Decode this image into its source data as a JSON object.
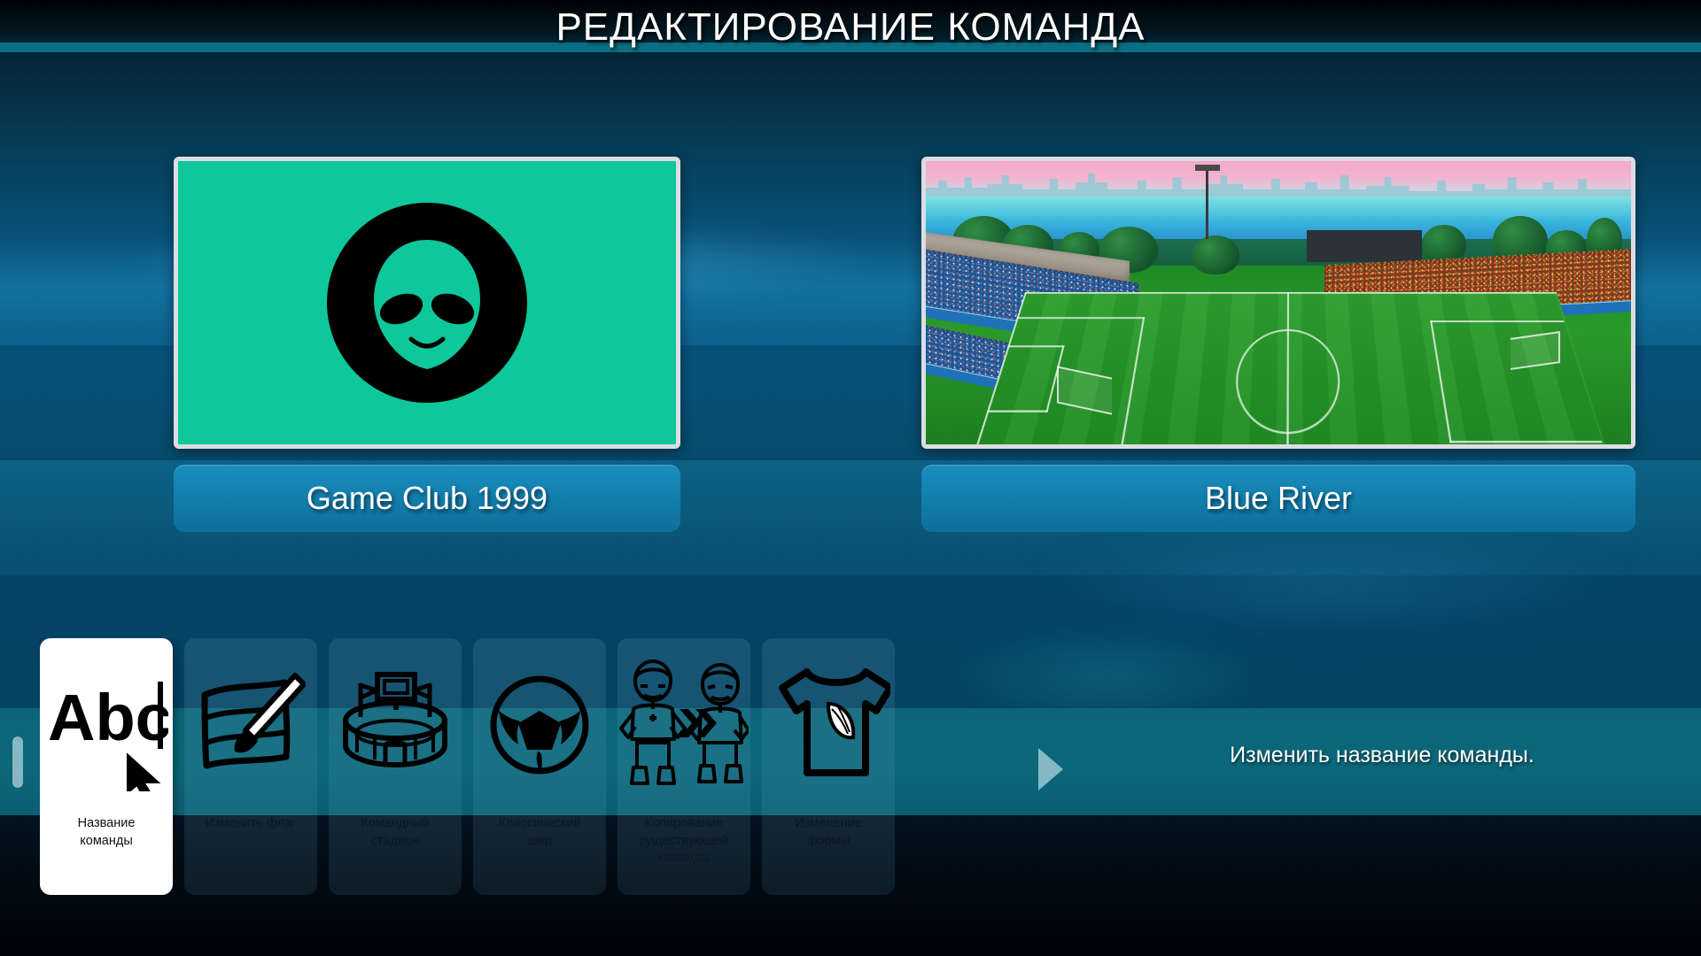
{
  "header": {
    "title": "РЕДАКТИРОВАНИЕ КОМАНДА"
  },
  "teams": {
    "left": {
      "name": "Game Club 1999",
      "thumbnail_kind": "team-flag",
      "flag_background_color": "#0ec79a",
      "emblem": "alien-head-icon",
      "selected": true
    },
    "right": {
      "name": "Blue River",
      "thumbnail_kind": "stadium-photo",
      "emblem": "stadium-scene",
      "selected": false
    }
  },
  "toolbar": {
    "scroll_left_indicator": "scroll-handle",
    "scroll_right_arrow": "chevron-right-icon",
    "items": [
      {
        "label": "Название\nкоманды",
        "icon": "abc-text-cursor-icon",
        "selected": true
      },
      {
        "label": "Изменить флаг",
        "icon": "flag-brush-icon",
        "selected": false
      },
      {
        "label": "Командный\nстадион",
        "icon": "stadium-icon",
        "selected": false
      },
      {
        "label": "Классический\nшар",
        "icon": "soccer-ball-icon",
        "selected": false
      },
      {
        "label": "Копирование\nсуществующей\nкоманды",
        "icon": "copy-team-players-icon",
        "selected": false
      },
      {
        "label": "Изменение\nформы",
        "icon": "tshirt-kit-icon",
        "selected": false
      }
    ]
  },
  "hint": {
    "text": "Изменить название команды."
  },
  "colors": {
    "title_text": "#ffffff",
    "header_stripe": "#0a6f83",
    "teal_band": "#0b6779",
    "name_plate": "#1ca0d5",
    "flag_green": "#0ec79a",
    "selected_card": "#ffffff",
    "arrow": "#8fc0cc"
  }
}
